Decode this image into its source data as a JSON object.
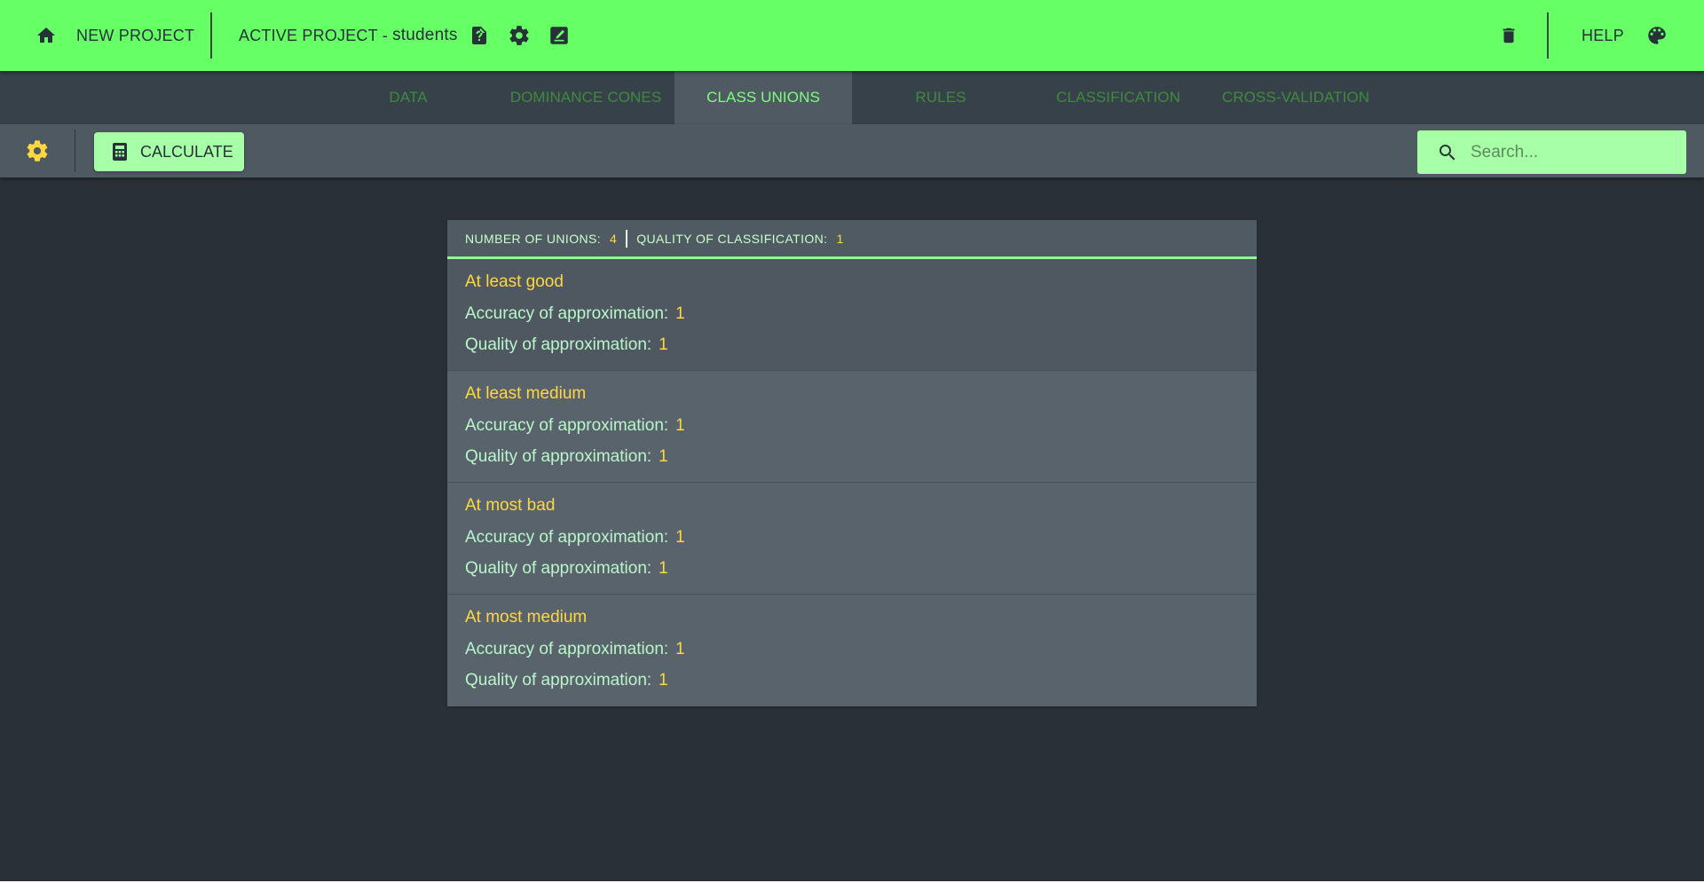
{
  "colors": {
    "topbar": "#66ff66",
    "tabs_bg": "#37414a",
    "active_tab": "#505a63",
    "toolbar": "#4e5961",
    "page_bg": "#2a3038",
    "accent_green": "#a7ffa7",
    "accent_yellow": "#ffd740"
  },
  "topbar": {
    "home_icon": "home-icon",
    "new_project_label": "NEW PROJECT",
    "active_project_label": "ACTIVE PROJECT - ",
    "project_name": "students",
    "file_help_icon": "file-question-icon",
    "settings_icon": "gear-icon",
    "rename_icon": "edit-icon",
    "delete_icon": "trash-icon",
    "help_label": "HELP",
    "theme_icon": "palette-icon"
  },
  "tabs": [
    {
      "label": "DATA",
      "active": false
    },
    {
      "label": "DOMINANCE CONES",
      "active": false
    },
    {
      "label": "CLASS UNIONS",
      "active": true
    },
    {
      "label": "RULES",
      "active": false
    },
    {
      "label": "CLASSIFICATION",
      "active": false
    },
    {
      "label": "CROSS-VALIDATION",
      "active": false
    }
  ],
  "toolbar": {
    "settings_icon": "gear-icon",
    "calculate_label": "CALCULATE",
    "calculate_icon": "calculator-icon",
    "search_placeholder": "Search...",
    "search_value": ""
  },
  "panel": {
    "header": {
      "unions_label": "NUMBER OF UNIONS:",
      "unions_value": "4",
      "quality_label": "QUALITY OF CLASSIFICATION:",
      "quality_value": "1"
    },
    "items": [
      {
        "title": "At least good",
        "accuracy_label": "Accuracy of approximation:",
        "accuracy_value": "1",
        "quality_label": "Quality of approximation:",
        "quality_value": "1"
      },
      {
        "title": "At least medium",
        "accuracy_label": "Accuracy of approximation:",
        "accuracy_value": "1",
        "quality_label": "Quality of approximation:",
        "quality_value": "1"
      },
      {
        "title": "At most bad",
        "accuracy_label": "Accuracy of approximation:",
        "accuracy_value": "1",
        "quality_label": "Quality of approximation:",
        "quality_value": "1"
      },
      {
        "title": "At most medium",
        "accuracy_label": "Accuracy of approximation:",
        "accuracy_value": "1",
        "quality_label": "Quality of approximation:",
        "quality_value": "1"
      }
    ]
  }
}
